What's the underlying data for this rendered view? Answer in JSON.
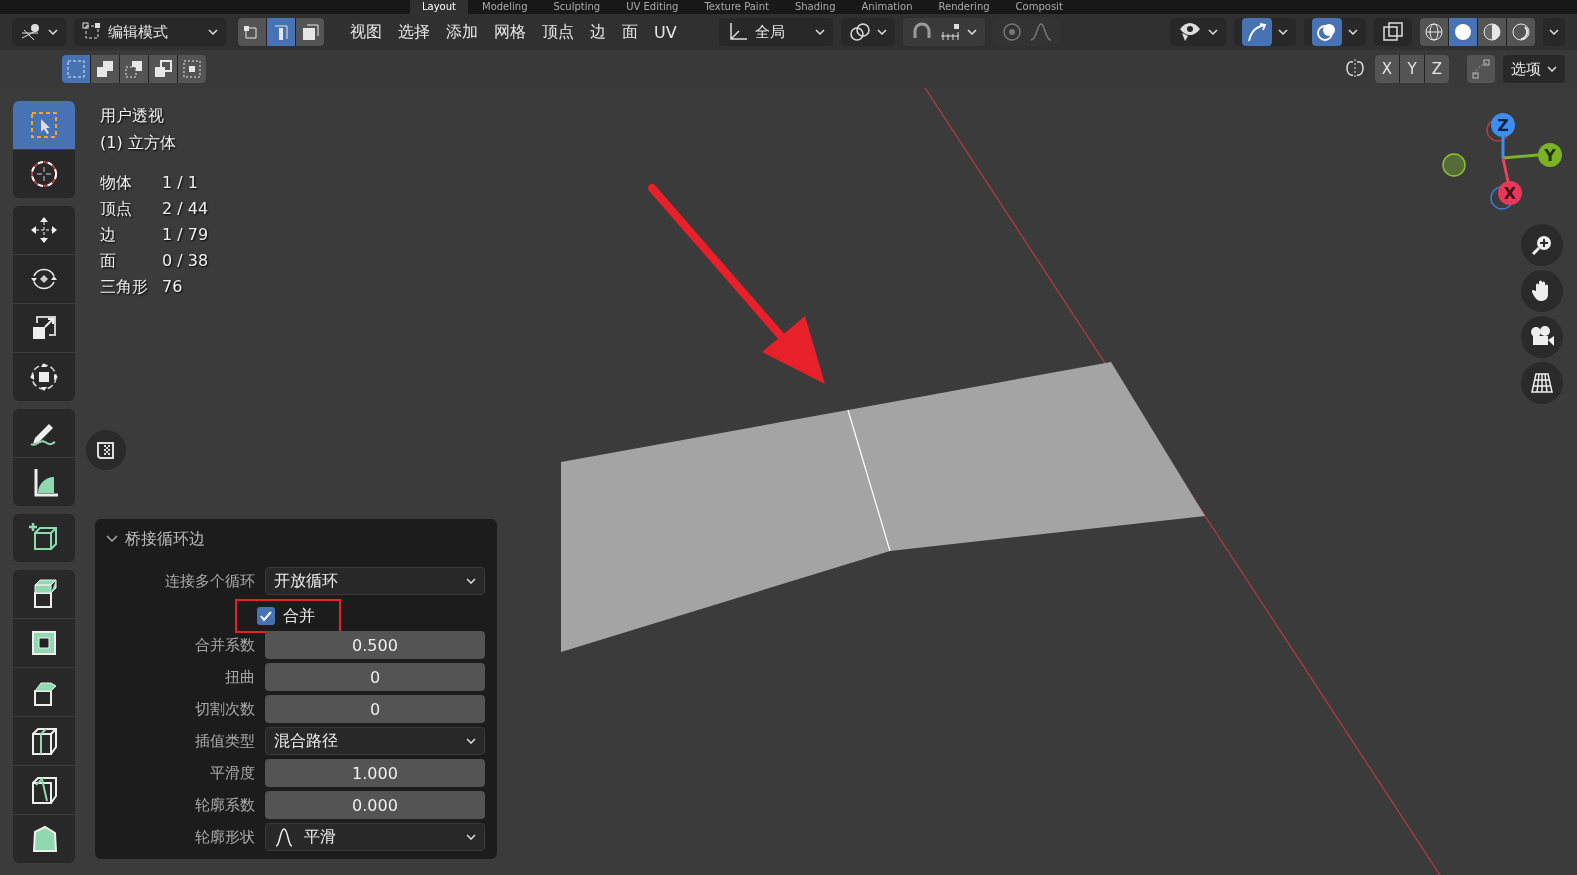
{
  "workspace_tabs": [
    {
      "label": "Layout",
      "selected": true
    },
    {
      "label": "Modeling",
      "selected": false
    },
    {
      "label": "Sculpting",
      "selected": false
    },
    {
      "label": "UV Editing",
      "selected": false
    },
    {
      "label": "Texture Paint",
      "selected": false
    },
    {
      "label": "Shading",
      "selected": false
    },
    {
      "label": "Animation",
      "selected": false
    },
    {
      "label": "Rendering",
      "selected": false
    },
    {
      "label": "Composit",
      "selected": false
    }
  ],
  "header": {
    "mode": "编辑模式",
    "select_modes": [
      {
        "kind": "vertex",
        "selected": false
      },
      {
        "kind": "edge",
        "selected": true
      },
      {
        "kind": "face",
        "selected": false
      }
    ],
    "menus": [
      "视图",
      "选择",
      "添加",
      "网格",
      "顶点",
      "边",
      "面",
      "UV"
    ],
    "orientation": "全局",
    "shading_modes": [
      {
        "kind": "wireframe",
        "selected": false
      },
      {
        "kind": "solid",
        "selected": true
      },
      {
        "kind": "material",
        "selected": false
      },
      {
        "kind": "rendered",
        "selected": false
      }
    ],
    "box_modes": [
      {
        "kind": "set",
        "selected": true
      },
      {
        "kind": "extend",
        "selected": false
      },
      {
        "kind": "subtract",
        "selected": false
      },
      {
        "kind": "invert",
        "selected": false
      },
      {
        "kind": "intersect",
        "selected": false
      }
    ],
    "mirror_axes": [
      "X",
      "Y",
      "Z"
    ],
    "options": "选项",
    "toggles": {
      "proportional_editing": false,
      "gizmos": true,
      "overlays": true
    }
  },
  "viewport": {
    "view_name": "用户透视",
    "object_name": "(1) 立方体",
    "stats": [
      {
        "label": "物体",
        "value": "1 / 1"
      },
      {
        "label": "顶点",
        "value": "2 / 44"
      },
      {
        "label": "边",
        "value": "1 / 79"
      },
      {
        "label": "面",
        "value": "0 / 38"
      },
      {
        "label": "三角形",
        "value": "76"
      }
    ],
    "gizmo_axes": [
      "Z",
      "Y",
      "X"
    ]
  },
  "toolbar": [
    {
      "tools": [
        {
          "kind": "select",
          "selected": true
        },
        {
          "kind": "cursor",
          "selected": false
        }
      ]
    },
    {
      "tools": [
        {
          "kind": "move",
          "selected": false
        },
        {
          "kind": "rotate",
          "selected": false
        },
        {
          "kind": "scale",
          "selected": false
        },
        {
          "kind": "transform",
          "selected": false
        }
      ]
    },
    {
      "tools": [
        {
          "kind": "annotate",
          "selected": false
        },
        {
          "kind": "measure",
          "selected": false
        }
      ]
    },
    {
      "tools": [
        {
          "kind": "add-cube",
          "selected": false
        }
      ]
    },
    {
      "tools": [
        {
          "kind": "extrude",
          "selected": false
        },
        {
          "kind": "inset",
          "selected": false
        },
        {
          "kind": "bevel",
          "selected": false
        },
        {
          "kind": "loopcut",
          "selected": false
        },
        {
          "kind": "knife",
          "selected": false
        },
        {
          "kind": "polybuild",
          "selected": false
        }
      ]
    }
  ],
  "operator_panel": {
    "title": "桥接循环边",
    "expanded": true,
    "fields": [
      {
        "kind": "dropdown",
        "label": "连接多个循环",
        "value": "开放循环"
      },
      {
        "kind": "checkbox",
        "label": "合并",
        "checked": true,
        "highlighted": true
      },
      {
        "kind": "number",
        "label": "合并系数",
        "value": "0.500"
      },
      {
        "kind": "number",
        "label": "扭曲",
        "value": "0"
      },
      {
        "kind": "number",
        "label": "切割次数",
        "value": "0"
      },
      {
        "kind": "dropdown",
        "label": "插值类型",
        "value": "混合路径"
      },
      {
        "kind": "number",
        "label": "平滑度",
        "value": "1.000"
      },
      {
        "kind": "number",
        "label": "轮廓系数",
        "value": "0.000"
      },
      {
        "kind": "curve-dropdown",
        "label": "轮廓形状",
        "value": "平滑"
      }
    ]
  }
}
